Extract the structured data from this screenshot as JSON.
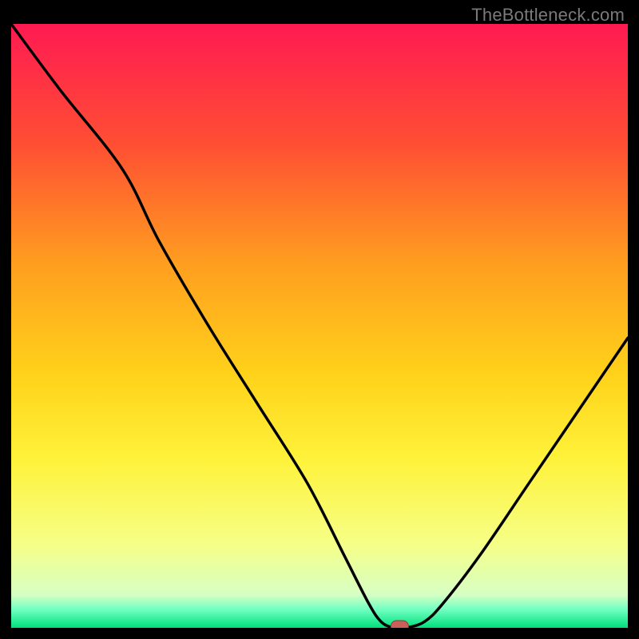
{
  "watermark": "TheBottleneck.com",
  "colors": {
    "frame": "#000000",
    "watermark": "#7a7a7a",
    "curve": "#000000",
    "marker_fill": "#c9605a",
    "marker_stroke": "#8f3d39",
    "gradient_stops": [
      {
        "offset": 0.0,
        "color": "#ff1a52"
      },
      {
        "offset": 0.2,
        "color": "#ff4f33"
      },
      {
        "offset": 0.4,
        "color": "#ff9f1f"
      },
      {
        "offset": 0.58,
        "color": "#ffd21a"
      },
      {
        "offset": 0.72,
        "color": "#fff23a"
      },
      {
        "offset": 0.86,
        "color": "#f6ff86"
      },
      {
        "offset": 0.945,
        "color": "#d7ffc4"
      },
      {
        "offset": 0.97,
        "color": "#6fffc1"
      },
      {
        "offset": 1.0,
        "color": "#00e07a"
      }
    ]
  },
  "chart_data": {
    "type": "line",
    "title": "",
    "xlabel": "",
    "ylabel": "",
    "xlim": [
      0,
      100
    ],
    "ylim": [
      0,
      100
    ],
    "grid": false,
    "legend": false,
    "series": [
      {
        "name": "bottleneck-curve",
        "x": [
          0,
          8,
          18,
          24,
          32,
          40,
          48,
          54,
          58,
          60,
          62,
          64,
          67,
          70,
          76,
          84,
          92,
          100
        ],
        "values": [
          100,
          89,
          76,
          64,
          50,
          37,
          24,
          12,
          4,
          1,
          0,
          0,
          1,
          4,
          12,
          24,
          36,
          48
        ]
      }
    ],
    "marker": {
      "x": 63,
      "y": 0
    },
    "annotations": []
  }
}
